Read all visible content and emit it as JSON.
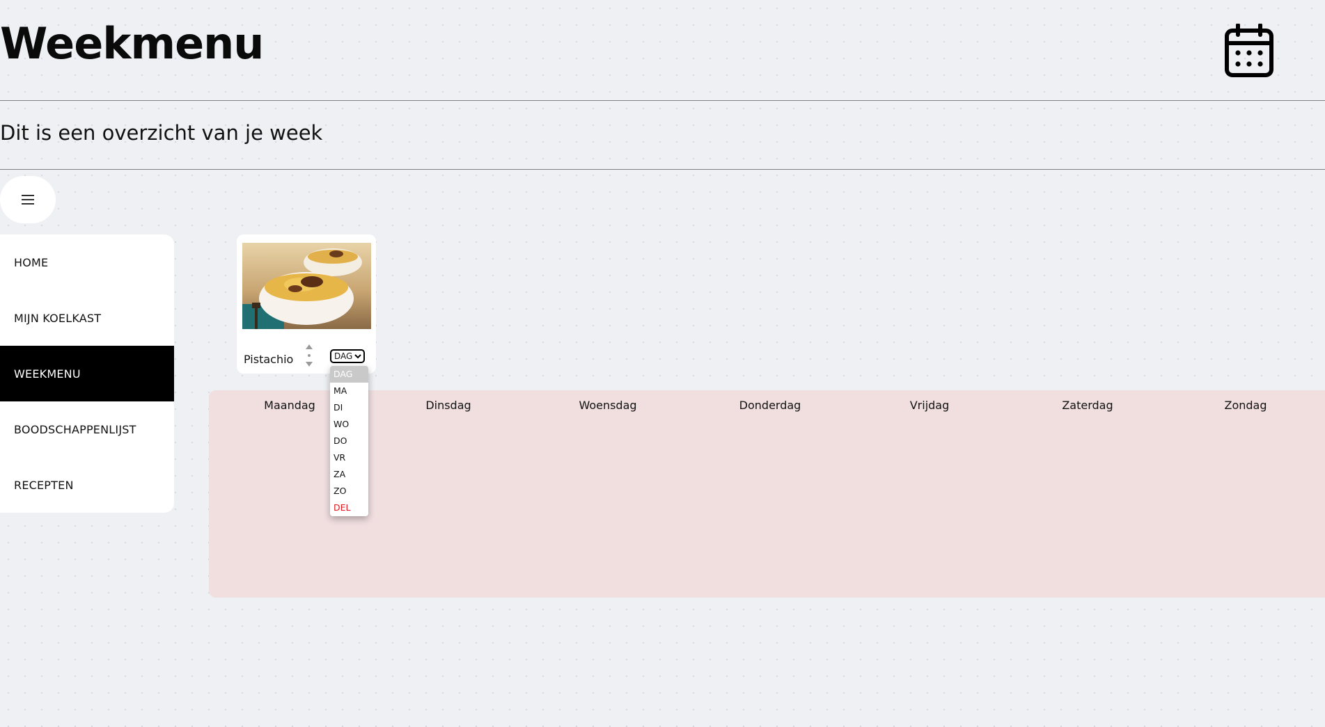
{
  "header": {
    "title": "Weekmenu",
    "subtitle": "Dit is een overzicht van je week"
  },
  "icons": {
    "calendar": "calendar-icon",
    "menu_toggle": "hamburger-menu-icon",
    "reorder": "sort-arrows-icon",
    "select_chevron": "chevron-down-icon"
  },
  "sidebar": {
    "items": [
      {
        "label": "HOME",
        "active": false
      },
      {
        "label": "MIJN KOELKAST",
        "active": false
      },
      {
        "label": "WEEKMENU",
        "active": true
      },
      {
        "label": "BOODSCHAPPENLIJST",
        "active": false
      },
      {
        "label": "RECEPTEN",
        "active": false
      }
    ]
  },
  "recipe": {
    "name": "Pistachio",
    "image_alt": "Twee kommen pasta",
    "day_select": {
      "selected": "DAG",
      "options": [
        "DAG",
        "MA",
        "DI",
        "WO",
        "DO",
        "VR",
        "ZA",
        "ZO",
        "DEL"
      ]
    }
  },
  "week": {
    "days": [
      "Maandag",
      "Dinsdag",
      "Woensdag",
      "Donderdag",
      "Vrijdag",
      "Zaterdag",
      "Zondag"
    ]
  },
  "colors": {
    "background": "#eef0f4",
    "week_grid": "#f1dfe0",
    "active_nav": "#000000",
    "delete_option": "#e0141b",
    "highlighted_option": "#c9c9c9"
  }
}
